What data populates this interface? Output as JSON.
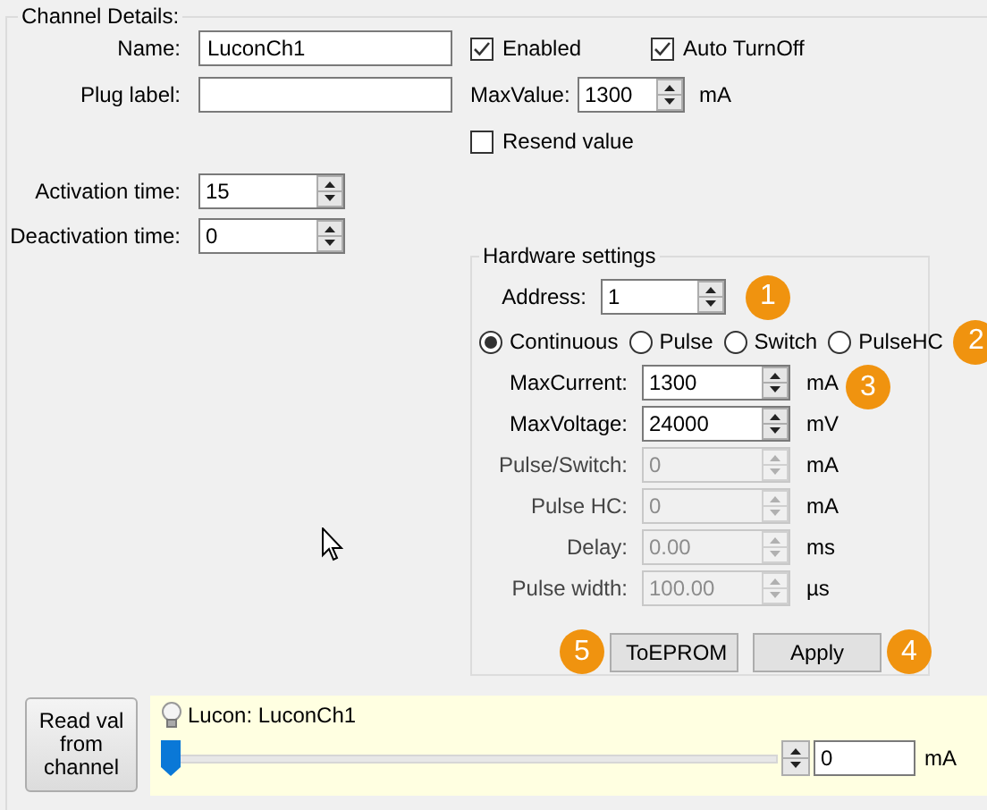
{
  "group_title": "Channel Details:",
  "name_field": {
    "label": "Name:",
    "value": "LuconCh1"
  },
  "plug_label_field": {
    "label": "Plug label:"
  },
  "activation_time": {
    "label": "Activation time:",
    "value": "15"
  },
  "deactivation_time": {
    "label": "Deactivation time:",
    "value": "0"
  },
  "checkboxes": [
    {
      "label": "Enabled",
      "checked": true
    },
    {
      "label": "Auto TurnOff",
      "checked": true
    }
  ],
  "max_value": {
    "label": "MaxValue:",
    "value": "1300",
    "unit": "mA"
  },
  "resend": {
    "label": "Resend value",
    "checked": false
  },
  "hardware": {
    "title": "Hardware settings",
    "address": {
      "label": "Address:",
      "value": "1",
      "badge": "1"
    },
    "modes": [
      {
        "label": "Continuous",
        "selected": true
      },
      {
        "label": "Pulse",
        "selected": false
      },
      {
        "label": "Switch",
        "selected": false
      },
      {
        "label": "PulseHC",
        "selected": false
      }
    ],
    "modes_badge": "2",
    "fields": [
      {
        "label": "MaxCurrent:",
        "value": "1300",
        "unit": "mA",
        "disabled": false
      },
      {
        "label": "MaxVoltage:",
        "value": "24000",
        "unit": "mV",
        "disabled": false
      },
      {
        "label": "Pulse/Switch:",
        "value": "0",
        "unit": "mA",
        "disabled": true
      },
      {
        "label": "Pulse HC:",
        "value": "0",
        "unit": "mA",
        "disabled": true
      },
      {
        "label": "Delay:",
        "value": "0.00",
        "unit": "ms",
        "disabled": true
      },
      {
        "label": "Pulse width:",
        "value": "100.00",
        "unit": "µs",
        "disabled": true
      }
    ],
    "fields_badge": "3",
    "button_row": [
      {
        "kind": "badge",
        "text": "5"
      },
      {
        "kind": "button",
        "label": "ToEPROM"
      },
      {
        "kind": "button",
        "label": "Apply"
      },
      {
        "kind": "badge",
        "text": "4"
      }
    ]
  },
  "bottom": {
    "read_button": "Read val from channel",
    "device_label": "Lucon: LuconCh1",
    "slider": {
      "level": 0
    },
    "value": "0",
    "unit": "mA"
  }
}
